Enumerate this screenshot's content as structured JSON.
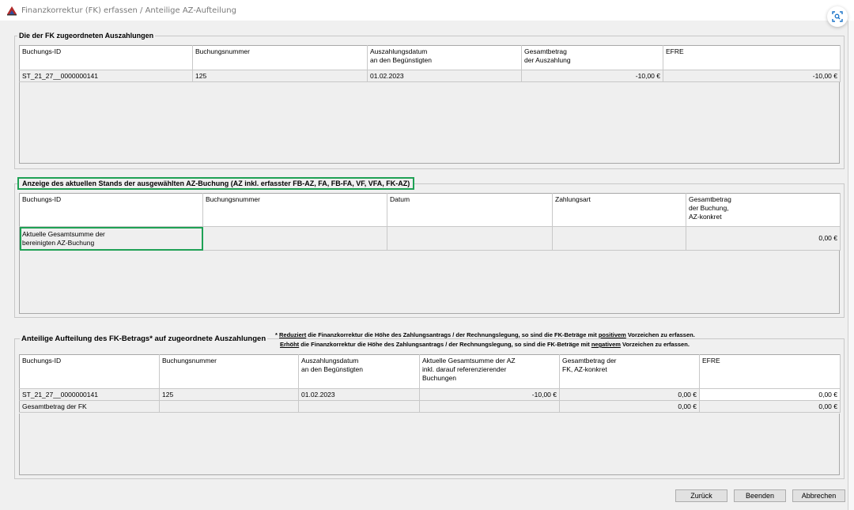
{
  "window": {
    "title": "Finanzkorrektur (FK) erfassen / Anteilige AZ-Aufteilung",
    "app_icon": "app-logo-icon",
    "expand_icon": "expand-icon"
  },
  "section1": {
    "legend": "Die der FK zugeordneten Auszahlungen",
    "headers": [
      "Buchungs-ID",
      "Buchungsnummer",
      "Auszahlungsdatum\nan den Begünstigten",
      "Gesamtbetrag\nder Auszahlung",
      "EFRE"
    ],
    "rows": [
      [
        "ST_21_27__0000000141",
        "125",
        "01.02.2023",
        "-10,00 €",
        "-10,00 €"
      ]
    ]
  },
  "section2": {
    "legend": "Anzeige des aktuellen Stands der ausgewählten AZ-Buchung (AZ inkl. erfasster FB-AZ, FA, FB-FA, VF, VFA, FK-AZ)",
    "headers": [
      "Buchungs-ID",
      "Buchungsnummer",
      "Datum",
      "Zahlungsart",
      "Gesamtbetrag\nder Buchung,\nAZ-konkret"
    ],
    "rows": [
      [
        "Aktuelle Gesamtsumme der\nbereinigten AZ-Buchung",
        "",
        "",
        "",
        "0,00 €"
      ]
    ]
  },
  "section3": {
    "legend": "Anteilige Aufteilung des FK-Betrags* auf zugeordnete Auszahlungen",
    "note1_prefix": "* ",
    "note1_u": "Reduziert",
    "note1_mid": " die Finanzkorrektur die Höhe des Zahlungsantrags / der Rechnungslegung, so sind die FK-Beträge mit ",
    "note1_u2": "positivem",
    "note1_end": " Vorzeichen zu erfassen.",
    "note2_u": "Erhöht",
    "note2_mid": " die Finanzkorrektur die Höhe des Zahlungsantrags / der Rechnungslegung, so sind die FK-Beträge mit ",
    "note2_u2": "negativem",
    "note2_end": " Vorzeichen zu erfassen.",
    "headers": [
      "Buchungs-ID",
      "Buchungsnummer",
      "Auszahlungsdatum\nan den Begünstigten",
      "Aktuelle Gesamtsumme der AZ\ninkl. darauf referenzierender\nBuchungen",
      "Gesamtbetrag der\nFK, AZ-konkret",
      "EFRE"
    ],
    "rows": [
      [
        "ST_21_27__0000000141",
        "125",
        "01.02.2023",
        "-10,00 €",
        "0,00 €",
        "0,00 €"
      ],
      [
        "Gesamtbetrag der FK",
        "",
        "",
        "",
        "0,00 €",
        "0,00 €"
      ]
    ]
  },
  "buttons": {
    "back": "Zurück",
    "finish": "Beenden",
    "cancel": "Abbrechen"
  }
}
